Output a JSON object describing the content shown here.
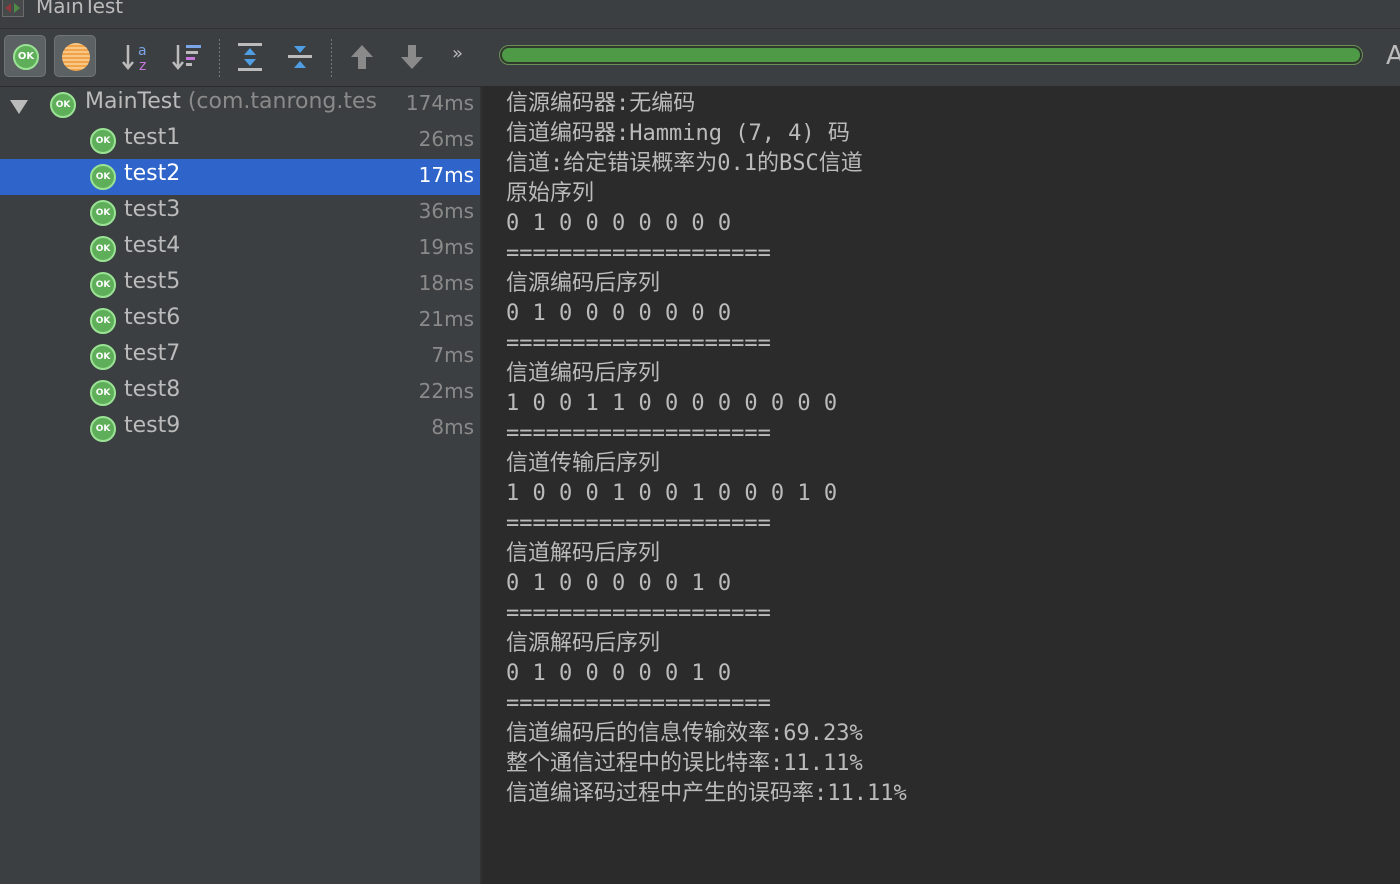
{
  "window": {
    "title": "MainTest"
  },
  "toolbar": {
    "show_passed_badge": "OK",
    "more_label": "»",
    "cut_label": "A",
    "progress_fraction": 1.0,
    "progress_color": "#4e9a47"
  },
  "tree": {
    "root": {
      "badge": "OK",
      "name": "MainTest",
      "package": " (com.tanrong.tes",
      "time": "174ms"
    },
    "tests": [
      {
        "badge": "OK",
        "name": "test1",
        "time": "26ms"
      },
      {
        "badge": "OK",
        "name": "test2",
        "time": "17ms",
        "selected": true
      },
      {
        "badge": "OK",
        "name": "test3",
        "time": "36ms"
      },
      {
        "badge": "OK",
        "name": "test4",
        "time": "19ms"
      },
      {
        "badge": "OK",
        "name": "test5",
        "time": "18ms"
      },
      {
        "badge": "OK",
        "name": "test6",
        "time": "21ms"
      },
      {
        "badge": "OK",
        "name": "test7",
        "time": "7ms"
      },
      {
        "badge": "OK",
        "name": "test8",
        "time": "22ms"
      },
      {
        "badge": "OK",
        "name": "test9",
        "time": "8ms"
      }
    ]
  },
  "console": {
    "lines": [
      "信源编码器:无编码",
      "信道编码器:Hamming (7, 4) 码",
      "信道:给定错误概率为0.1的BSC信道",
      "原始序列",
      "0 1 0 0 0 0 0 0 0",
      "====================",
      "信源编码后序列",
      "0 1 0 0 0 0 0 0 0",
      "====================",
      "信道编码后序列",
      "1 0 0 1 1 0 0 0 0 0 0 0 0",
      "====================",
      "信道传输后序列",
      "1 0 0 0 1 0 0 1 0 0 0 1 0",
      "====================",
      "信道解码后序列",
      "0 1 0 0 0 0 0 1 0",
      "====================",
      "信源解码后序列",
      "0 1 0 0 0 0 0 1 0",
      "====================",
      "信道编码后的信息传输效率:69.23%",
      "整个通信过程中的误比特率:11.11%",
      "信道编译码过程中产生的误码率:11.11%"
    ]
  }
}
